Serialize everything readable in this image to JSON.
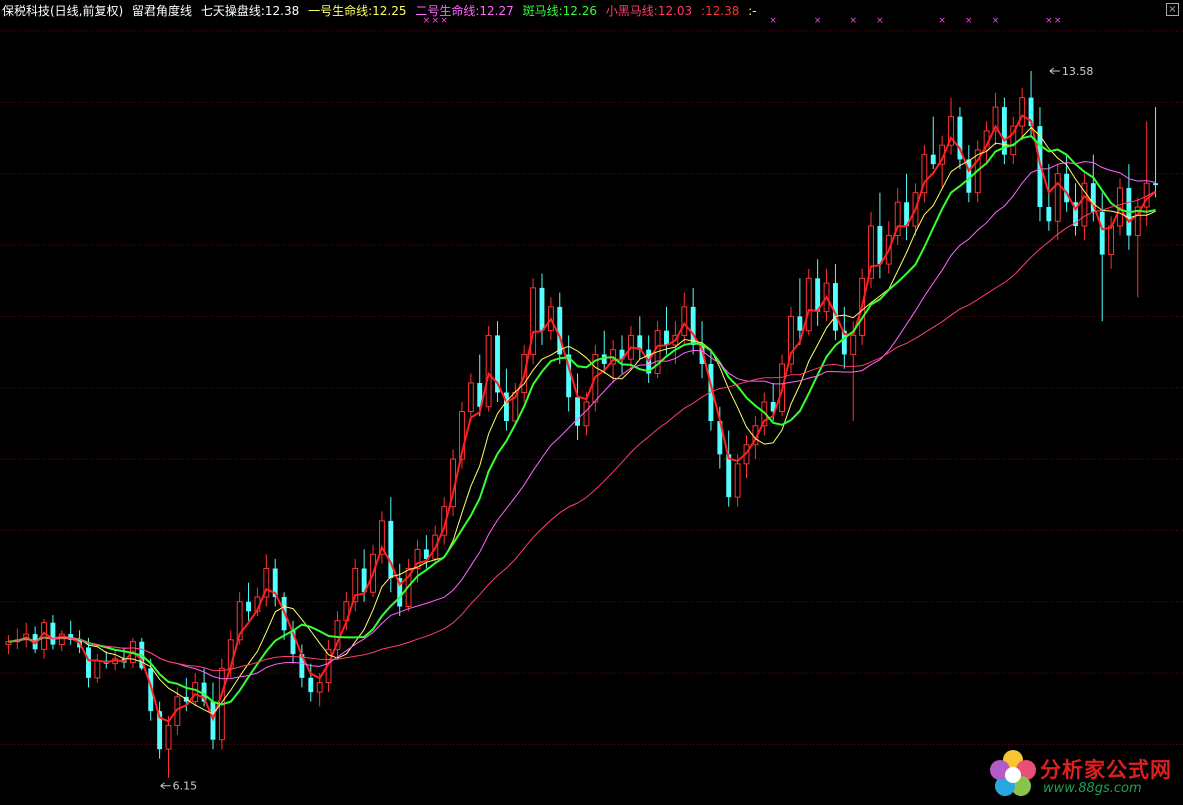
{
  "header": {
    "stock": "保税科技(日线,前复权)",
    "indicator": "留君角度线",
    "ma1": "七天操盘线:12.38",
    "ma2": "一号生命线:12.25",
    "ma3": "二号生命线:12.27",
    "ma4": "斑马线:12.26",
    "ma5": "小黑马线:12.03",
    "ma6": ":12.38",
    "ma7": ":-"
  },
  "colors": {
    "background": "#000000",
    "grid": "#7a0000",
    "up": "#ff3232",
    "down": "#54ffff",
    "ma1": "#ff2020",
    "ma2": "#ffff66",
    "ma3": "#ff66ff",
    "ma4": "#33ff33",
    "ma5": "#ff3c6e",
    "header_name": "#ffffff",
    "mark": "#ff44ff"
  },
  "watermark": {
    "name": "分析家公式网",
    "url": "www.88gs.com"
  },
  "chart_data": {
    "type": "candlestick",
    "ylim": [
      6.0,
      14.2
    ],
    "grid_levels": [
      6.5,
      7.25,
      8.0,
      8.75,
      9.5,
      10.25,
      11.0,
      11.75,
      12.5,
      13.25,
      14.0
    ],
    "annotations": [
      {
        "label": "13.58",
        "index": 117,
        "value": 13.58,
        "kind": "high"
      },
      {
        "label": "6.15",
        "index": 17,
        "value": 6.15,
        "kind": "low"
      }
    ],
    "mark_label": "×",
    "marks": [
      47,
      48,
      49,
      86,
      91,
      95,
      98,
      105,
      108,
      111,
      117,
      118
    ],
    "candles": [
      [
        7.55,
        7.65,
        7.45,
        7.58
      ],
      [
        7.58,
        7.72,
        7.5,
        7.6
      ],
      [
        7.6,
        7.78,
        7.52,
        7.66
      ],
      [
        7.66,
        7.74,
        7.46,
        7.5
      ],
      [
        7.5,
        7.82,
        7.4,
        7.78
      ],
      [
        7.78,
        7.86,
        7.5,
        7.55
      ],
      [
        7.55,
        7.7,
        7.48,
        7.66
      ],
      [
        7.66,
        7.8,
        7.55,
        7.6
      ],
      [
        7.6,
        7.7,
        7.46,
        7.52
      ],
      [
        7.52,
        7.62,
        7.1,
        7.2
      ],
      [
        7.2,
        7.45,
        7.15,
        7.38
      ],
      [
        7.38,
        7.48,
        7.3,
        7.35
      ],
      [
        7.35,
        7.5,
        7.28,
        7.4
      ],
      [
        7.4,
        7.52,
        7.3,
        7.36
      ],
      [
        7.36,
        7.62,
        7.3,
        7.58
      ],
      [
        7.58,
        7.62,
        7.28,
        7.3
      ],
      [
        7.3,
        7.4,
        6.75,
        6.85
      ],
      [
        6.85,
        6.95,
        6.35,
        6.45
      ],
      [
        6.45,
        6.8,
        6.15,
        6.7
      ],
      [
        6.7,
        7.1,
        6.6,
        7.0
      ],
      [
        7.0,
        7.2,
        6.85,
        6.95
      ],
      [
        6.95,
        7.25,
        6.9,
        7.15
      ],
      [
        7.15,
        7.3,
        6.9,
        6.95
      ],
      [
        6.95,
        7.15,
        6.45,
        6.55
      ],
      [
        6.55,
        7.4,
        6.45,
        7.3
      ],
      [
        7.3,
        7.7,
        7.2,
        7.6
      ],
      [
        7.6,
        8.1,
        7.55,
        8.0
      ],
      [
        8.0,
        8.2,
        7.8,
        7.9
      ],
      [
        7.9,
        8.15,
        7.85,
        8.05
      ],
      [
        8.05,
        8.5,
        7.95,
        8.35
      ],
      [
        8.35,
        8.45,
        7.95,
        8.05
      ],
      [
        8.05,
        8.1,
        7.6,
        7.7
      ],
      [
        7.7,
        7.8,
        7.35,
        7.45
      ],
      [
        7.45,
        7.55,
        7.1,
        7.2
      ],
      [
        7.2,
        7.35,
        6.95,
        7.05
      ],
      [
        7.05,
        7.25,
        6.9,
        7.15
      ],
      [
        7.15,
        7.6,
        7.05,
        7.5
      ],
      [
        7.5,
        7.9,
        7.4,
        7.8
      ],
      [
        7.8,
        8.1,
        7.7,
        8.0
      ],
      [
        8.0,
        8.45,
        7.9,
        8.35
      ],
      [
        8.35,
        8.55,
        8.0,
        8.1
      ],
      [
        8.1,
        8.6,
        8.05,
        8.5
      ],
      [
        8.5,
        8.95,
        8.4,
        8.85
      ],
      [
        8.85,
        9.1,
        8.1,
        8.25
      ],
      [
        8.25,
        8.4,
        7.85,
        7.95
      ],
      [
        7.95,
        8.45,
        7.9,
        8.35
      ],
      [
        8.35,
        8.65,
        8.2,
        8.55
      ],
      [
        8.55,
        8.7,
        8.35,
        8.45
      ],
      [
        8.45,
        8.8,
        8.4,
        8.7
      ],
      [
        8.7,
        9.1,
        8.6,
        9.0
      ],
      [
        9.0,
        9.6,
        8.9,
        9.5
      ],
      [
        9.5,
        10.1,
        9.4,
        10.0
      ],
      [
        10.0,
        10.4,
        9.9,
        10.3
      ],
      [
        10.3,
        10.6,
        9.95,
        10.05
      ],
      [
        10.05,
        10.9,
        10.0,
        10.8
      ],
      [
        10.8,
        10.95,
        10.1,
        10.2
      ],
      [
        10.2,
        10.45,
        9.8,
        9.9
      ],
      [
        9.9,
        10.3,
        9.85,
        10.2
      ],
      [
        10.2,
        10.7,
        10.1,
        10.6
      ],
      [
        10.6,
        11.4,
        10.5,
        11.3
      ],
      [
        11.3,
        11.45,
        10.7,
        10.85
      ],
      [
        10.85,
        11.2,
        10.75,
        11.1
      ],
      [
        11.1,
        11.25,
        10.5,
        10.6
      ],
      [
        10.6,
        10.8,
        10.0,
        10.15
      ],
      [
        10.15,
        10.4,
        9.7,
        9.85
      ],
      [
        9.85,
        10.2,
        9.75,
        10.1
      ],
      [
        10.1,
        10.7,
        10.0,
        10.6
      ],
      [
        10.6,
        10.85,
        10.4,
        10.5
      ],
      [
        10.5,
        10.75,
        10.3,
        10.65
      ],
      [
        10.65,
        10.8,
        10.4,
        10.55
      ],
      [
        10.55,
        10.9,
        10.45,
        10.8
      ],
      [
        10.8,
        11.0,
        10.55,
        10.65
      ],
      [
        10.65,
        10.8,
        10.3,
        10.4
      ],
      [
        10.4,
        10.95,
        10.35,
        10.85
      ],
      [
        10.85,
        11.1,
        10.6,
        10.7
      ],
      [
        10.7,
        10.95,
        10.5,
        10.8
      ],
      [
        10.8,
        11.25,
        10.7,
        11.1
      ],
      [
        11.1,
        11.3,
        10.6,
        10.7
      ],
      [
        10.7,
        10.95,
        10.35,
        10.5
      ],
      [
        10.5,
        10.65,
        9.8,
        9.9
      ],
      [
        9.9,
        10.05,
        9.4,
        9.55
      ],
      [
        9.55,
        9.8,
        9.0,
        9.1
      ],
      [
        9.1,
        9.55,
        9.0,
        9.45
      ],
      [
        9.45,
        9.75,
        9.3,
        9.65
      ],
      [
        9.65,
        9.95,
        9.5,
        9.85
      ],
      [
        9.85,
        10.2,
        9.75,
        10.1
      ],
      [
        10.1,
        10.3,
        9.9,
        10.0
      ],
      [
        10.0,
        10.6,
        9.95,
        10.5
      ],
      [
        10.5,
        11.1,
        10.4,
        11.0
      ],
      [
        11.0,
        11.4,
        10.7,
        10.85
      ],
      [
        10.85,
        11.5,
        10.8,
        11.4
      ],
      [
        11.4,
        11.6,
        10.9,
        11.05
      ],
      [
        11.05,
        11.5,
        10.95,
        11.35
      ],
      [
        11.35,
        11.55,
        10.75,
        10.85
      ],
      [
        10.85,
        11.1,
        10.45,
        10.6
      ],
      [
        10.6,
        10.95,
        9.9,
        10.8
      ],
      [
        10.8,
        11.5,
        10.7,
        11.4
      ],
      [
        11.4,
        12.1,
        11.3,
        11.95
      ],
      [
        11.95,
        12.3,
        11.4,
        11.55
      ],
      [
        11.55,
        12.0,
        11.45,
        11.85
      ],
      [
        11.85,
        12.35,
        11.75,
        12.2
      ],
      [
        12.2,
        12.5,
        11.8,
        11.95
      ],
      [
        11.95,
        12.4,
        11.85,
        12.3
      ],
      [
        12.3,
        12.8,
        12.2,
        12.7
      ],
      [
        12.7,
        13.1,
        12.55,
        12.6
      ],
      [
        12.6,
        12.9,
        12.35,
        12.8
      ],
      [
        12.8,
        13.3,
        12.7,
        13.1
      ],
      [
        13.1,
        13.2,
        12.55,
        12.65
      ],
      [
        12.65,
        12.8,
        12.2,
        12.3
      ],
      [
        12.3,
        12.85,
        12.2,
        12.75
      ],
      [
        12.75,
        13.05,
        12.6,
        12.95
      ],
      [
        12.95,
        13.35,
        12.8,
        13.2
      ],
      [
        13.2,
        13.3,
        12.6,
        12.7
      ],
      [
        12.7,
        13.1,
        12.6,
        13.0
      ],
      [
        13.0,
        13.4,
        12.85,
        13.3
      ],
      [
        13.3,
        13.58,
        12.9,
        13.0
      ],
      [
        13.0,
        13.2,
        12.0,
        12.15
      ],
      [
        12.15,
        12.6,
        11.9,
        12.0
      ],
      [
        12.0,
        12.6,
        11.8,
        12.5
      ],
      [
        12.5,
        12.7,
        12.1,
        12.2
      ],
      [
        12.2,
        12.4,
        11.85,
        11.95
      ],
      [
        11.95,
        12.5,
        11.8,
        12.4
      ],
      [
        12.4,
        12.7,
        12.0,
        12.1
      ],
      [
        12.1,
        12.3,
        10.95,
        11.65
      ],
      [
        11.65,
        12.05,
        11.5,
        11.95
      ],
      [
        11.95,
        12.45,
        11.85,
        12.35
      ],
      [
        12.35,
        12.6,
        11.7,
        11.85
      ],
      [
        11.85,
        12.25,
        11.2,
        12.15
      ],
      [
        12.15,
        13.05,
        11.95,
        12.4
      ],
      [
        12.4,
        13.2,
        12.25,
        12.38
      ]
    ]
  }
}
